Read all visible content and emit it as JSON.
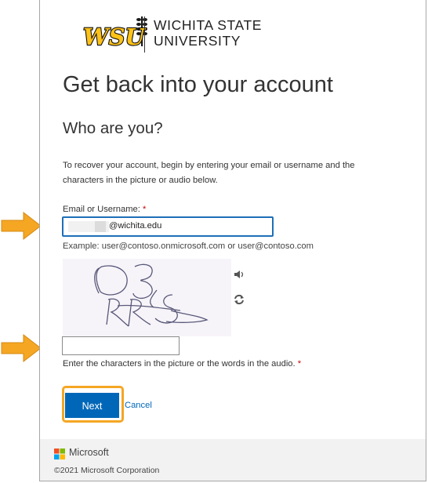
{
  "university": {
    "name_line1": "Wichita State",
    "name_line2": "University",
    "logo_text": "WSU"
  },
  "page": {
    "title": "Get back into your account",
    "subtitle": "Who are you?",
    "instructions": "To recover your account, begin by entering your email or username and the characters in the picture or audio below."
  },
  "email": {
    "label": "Email or Username: ",
    "required_mark": "*",
    "value": "@wichita.edu",
    "example": "Example: user@contoso.onmicrosoft.com or user@contoso.com"
  },
  "captcha": {
    "image_text": "D3RR5",
    "audio_icon": "speaker-icon",
    "refresh_icon": "refresh-icon",
    "value": "",
    "help": "Enter the characters in the picture or the words in the audio. ",
    "required_mark": "*"
  },
  "actions": {
    "next_label": "Next",
    "cancel_label": "Cancel"
  },
  "footer": {
    "brand": "Microsoft",
    "copyright": "©2021 Microsoft Corporation"
  },
  "colors": {
    "primary": "#0067b8",
    "highlight": "#f5a623",
    "wsu_gold": "#ffc217",
    "required": "#c00000"
  }
}
